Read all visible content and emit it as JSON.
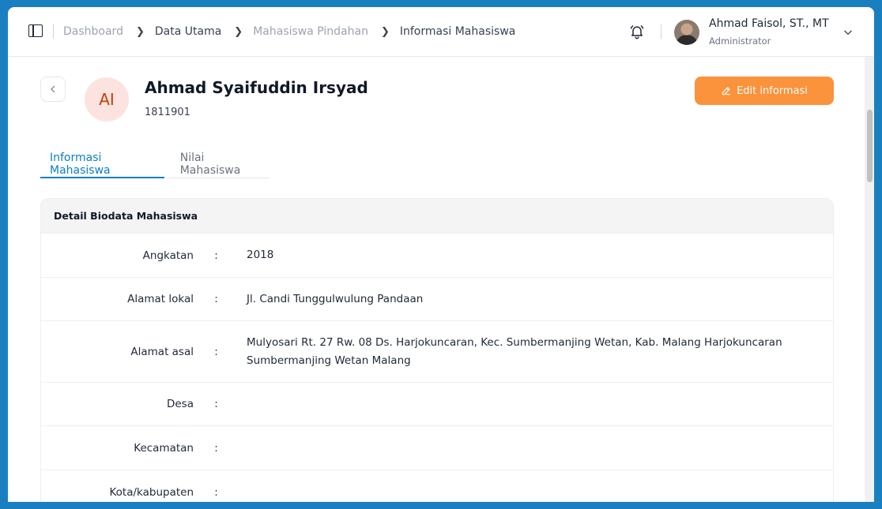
{
  "header": {
    "breadcrumb": [
      "Dashboard",
      "Data Utama",
      "Mahasiswa Pindahan",
      "Informasi Mahasiswa"
    ],
    "user_name": "Ahmad Faisol, ST., MT",
    "user_role": "Administrator"
  },
  "profile": {
    "initials": "AI",
    "name": "Ahmad Syaifuddin Irsyad",
    "nim": "1811901",
    "edit_label": "Edit informasi"
  },
  "tabs": [
    {
      "label": "Informasi Mahasiswa"
    },
    {
      "label": "Nilai Mahasiswa"
    }
  ],
  "card": {
    "title": "Detail Biodata Mahasiswa",
    "colon": ":",
    "rows": [
      {
        "label": "Angkatan",
        "value": "2018"
      },
      {
        "label": "Alamat lokal",
        "value": "Jl. Candi Tunggulwulung Pandaan"
      },
      {
        "label": "Alamat asal",
        "value": "Mulyosari Rt. 27 Rw. 08 Ds. Harjokuncaran, Kec. Sumbermanjing Wetan, Kab. Malang Harjokuncaran Sumbermanjing Wetan Malang"
      },
      {
        "label": "Desa",
        "value": ""
      },
      {
        "label": "Kecamatan",
        "value": ""
      },
      {
        "label": "Kota/kabupaten",
        "value": ""
      }
    ]
  },
  "colors": {
    "accent": "#0b7fc6",
    "edit_button": "#fb923c",
    "background": "#1a7fc1"
  }
}
